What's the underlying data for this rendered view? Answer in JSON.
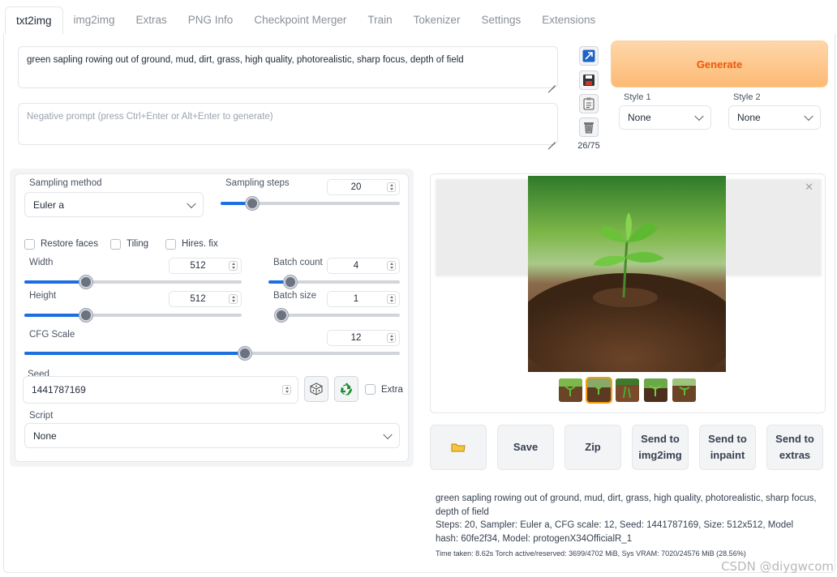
{
  "tabs": [
    "txt2img",
    "img2img",
    "Extras",
    "PNG Info",
    "Checkpoint Merger",
    "Train",
    "Tokenizer",
    "Settings",
    "Extensions"
  ],
  "prompt": {
    "positive": "green sapling rowing out of ground, mud, dirt, grass, high quality, photorealistic, sharp focus, depth of field",
    "negative_placeholder": "Negative prompt (press Ctrl+Enter or Alt+Enter to generate)",
    "token_count": "26/75"
  },
  "tool_icons": [
    "arrow-icon",
    "save-icon",
    "clipboard-icon",
    "trash-icon"
  ],
  "generate_label": "Generate",
  "styles": {
    "style1_label": "Style 1",
    "style1_value": "None",
    "style2_label": "Style 2",
    "style2_value": "None"
  },
  "params": {
    "sampling_method_label": "Sampling method",
    "sampling_method": "Euler a",
    "sampling_steps_label": "Sampling steps",
    "sampling_steps": "20",
    "restore_faces": "Restore faces",
    "tiling": "Tiling",
    "hires_fix": "Hires. fix",
    "width_label": "Width",
    "width": "512",
    "batch_count_label": "Batch count",
    "batch_count": "4",
    "height_label": "Height",
    "height": "512",
    "batch_size_label": "Batch size",
    "batch_size": "1",
    "cfg_label": "CFG Scale",
    "cfg": "12",
    "seed_label": "Seed",
    "seed": "1441787169",
    "extra_label": "Extra",
    "script_label": "Script",
    "script": "None"
  },
  "slider_levels": {
    "sampling_steps": 0.15,
    "width": 0.27,
    "batch_count": 0.13,
    "height": 0.27,
    "batch_size": 0.0,
    "cfg": 0.59
  },
  "actions": {
    "folder": "folder-icon",
    "save": "Save",
    "zip": "Zip",
    "send_img2img": "Send to img2img",
    "send_inpaint": "Send to inpaint",
    "send_extras": "Send to extras"
  },
  "info": {
    "prompt_line": "green sapling rowing out of ground, mud, dirt, grass, high quality, photorealistic, sharp focus, depth of field",
    "params_line": "Steps: 20, Sampler: Euler a, CFG scale: 12, Seed: 1441787169, Size: 512x512, Model hash: 60fe2f34, Model: protogenX34OfficialR_1",
    "time_line": "Time taken: 8.62s  Torch active/reserved: 3699/4702 MiB, Sys VRAM: 7020/24576 MiB (28.56%)"
  },
  "watermark": "CSDN @diygwcom",
  "colors": {
    "accent": "#1d6fe0",
    "generate": "#fdba74",
    "generate_text": "#ea580c"
  }
}
